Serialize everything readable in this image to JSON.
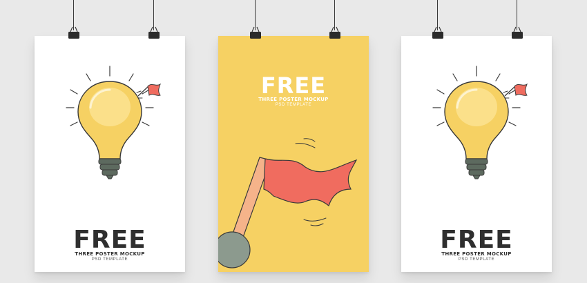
{
  "colors": {
    "background": "#e9e9e9",
    "poster_white": "#ffffff",
    "poster_yellow": "#f6d163",
    "bulb_yellow": "#f6d163",
    "bulb_base": "#5d6a5f",
    "flag_red": "#f06c5f",
    "pole": "#f5b38a",
    "text_dark": "#2f2f2f"
  },
  "posters": [
    {
      "title": "FREE",
      "subtitle": "THREE POSTER MOCKUP",
      "tagline": "PSD TEMPLATE",
      "icon": "lightbulb-icon"
    },
    {
      "title": "FREE",
      "subtitle": "THREE POSTER MOCKUP",
      "tagline": "PSD TEMPLATE",
      "icon": "flag-icon"
    },
    {
      "title": "FREE",
      "subtitle": "THREE POSTER MOCKUP",
      "tagline": "PSD TEMPLATE",
      "icon": "lightbulb-icon"
    }
  ]
}
